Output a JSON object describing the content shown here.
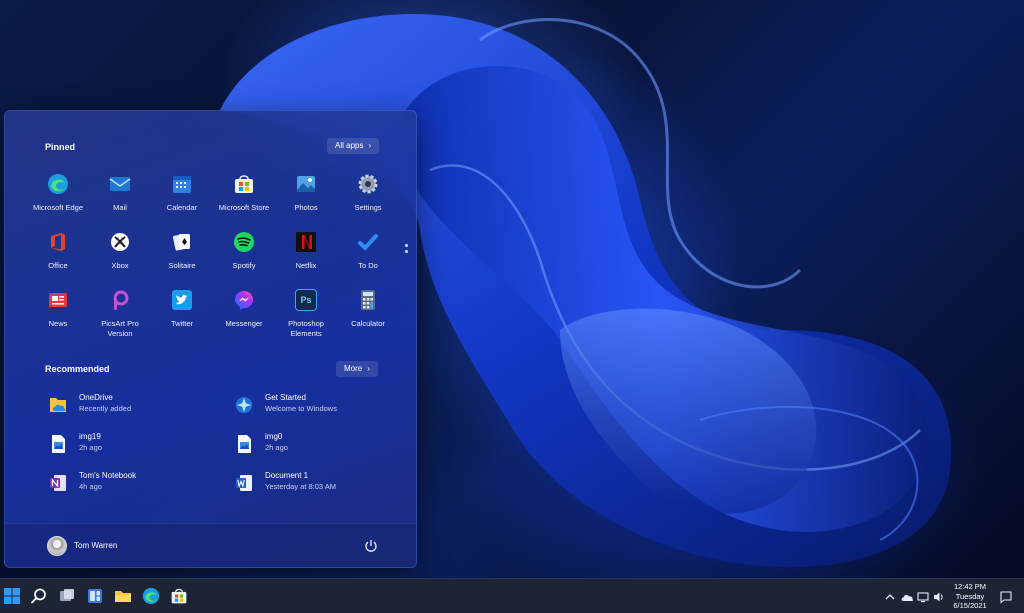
{
  "start_menu": {
    "pinned_title": "Pinned",
    "all_apps_label": "All apps",
    "pinned_apps": [
      {
        "label": "Microsoft Edge",
        "icon": "edge-icon",
        "color": "#1b9de2"
      },
      {
        "label": "Mail",
        "icon": "mail-icon",
        "color": "#1e79d6"
      },
      {
        "label": "Calendar",
        "icon": "calendar-icon",
        "color": "#2f80e8"
      },
      {
        "label": "Microsoft Store",
        "icon": "store-icon",
        "color": "#f2f2f2"
      },
      {
        "label": "Photos",
        "icon": "photos-icon",
        "color": "#4da3e8"
      },
      {
        "label": "Settings",
        "icon": "settings-icon",
        "color": "#8f9cb3"
      },
      {
        "label": "Office",
        "icon": "office-icon",
        "color": "#e0442a"
      },
      {
        "label": "Xbox",
        "icon": "xbox-icon",
        "color": "#ffffff"
      },
      {
        "label": "Solitaire",
        "icon": "solitaire-icon",
        "color": "#1f3a6e"
      },
      {
        "label": "Spotify",
        "icon": "spotify-icon",
        "color": "#1ed760"
      },
      {
        "label": "Netflix",
        "icon": "netflix-icon",
        "color": "#111111"
      },
      {
        "label": "To Do",
        "icon": "todo-icon",
        "color": "#2e8bf0"
      },
      {
        "label": "News",
        "icon": "news-icon",
        "color": "#e8383d"
      },
      {
        "label": "PicsArt Pro Version",
        "icon": "picsart-icon",
        "color": "#c44fd8"
      },
      {
        "label": "Twitter",
        "icon": "twitter-icon",
        "color": "#1d9bf0"
      },
      {
        "label": "Messenger",
        "icon": "messenger-icon",
        "color": "#8e4cf6"
      },
      {
        "label": "Photoshop Elements",
        "icon": "photoshop-icon",
        "color": "#0f2a4a"
      },
      {
        "label": "Calculator",
        "icon": "calculator-icon",
        "color": "#5d6b82"
      }
    ],
    "recommended_title": "Recommended",
    "more_label": "More",
    "recommended": [
      {
        "name": "OneDrive",
        "sub": "Recently added",
        "icon": "onedrive-icon"
      },
      {
        "name": "Get Started",
        "sub": "Welcome to Windows",
        "icon": "get-started-icon"
      },
      {
        "name": "img19",
        "sub": "2h ago",
        "icon": "image-file-icon"
      },
      {
        "name": "img0",
        "sub": "2h ago",
        "icon": "image-file-icon"
      },
      {
        "name": "Tom's Notebook",
        "sub": "4h ago",
        "icon": "onenote-icon"
      },
      {
        "name": "Document 1",
        "sub": "Yesterday at 8:03 AM",
        "icon": "word-file-icon"
      }
    ],
    "user_name": "Tom Warren"
  },
  "taskbar": {
    "clock": {
      "time": "12:42 PM",
      "day": "Tuesday",
      "date": "6/15/2021"
    },
    "accent": "#2f80e8"
  }
}
